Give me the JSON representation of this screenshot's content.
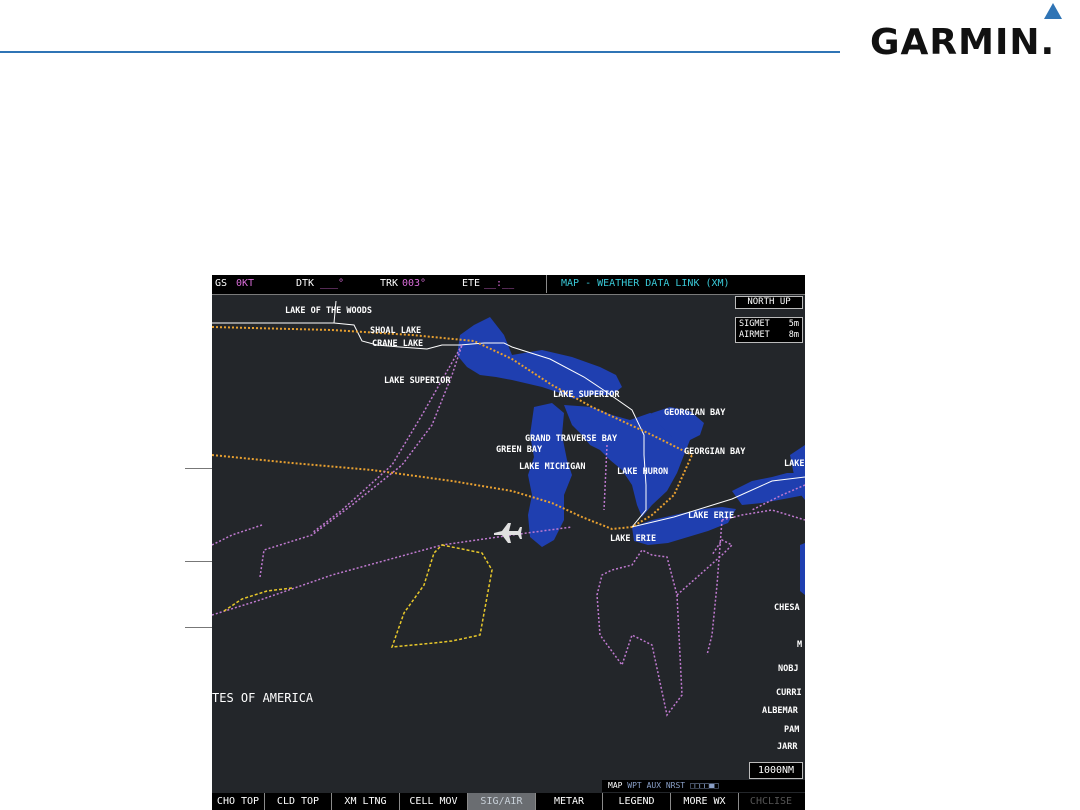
{
  "logo": {
    "text": "GARMIN."
  },
  "topbar": {
    "gs_label": "GS",
    "gs_value": "0KT",
    "dtk_label": "DTK",
    "dtk_value": "___°",
    "trk_label": "TRK",
    "trk_value": "003°",
    "ete_label": "ETE",
    "ete_value": "__:__"
  },
  "page_title": "MAP - WEATHER DATA LINK (XM)",
  "orientation": "NORTH UP",
  "wx_ages": {
    "sigmet_label": "SIGMET",
    "sigmet_age": "5m",
    "airmet_label": "AIRMET",
    "airmet_age": "8m"
  },
  "map_labels": {
    "lake_of_the_woods": "LAKE OF THE WOODS",
    "shoal_lake": "SHOAL LAKE",
    "crane_lake": "CRANE LAKE",
    "lake_superior_w": "LAKE SUPERIOR",
    "lake_superior_e": "LAKE SUPERIOR",
    "georgian_bay_n": "GEORGIAN BAY",
    "georgian_bay_s": "GEORGIAN BAY",
    "grand_traverse_bay": "GRAND TRAVERSE BAY",
    "green_bay": "GREEN BAY",
    "lake_michigan": "LAKE MICHIGAN",
    "lake_huron": "LAKE HURON",
    "lake_erie_e": "LAKE ERIE",
    "lake_erie_w": "LAKE ERIE",
    "lake_edge": "LAKE",
    "country": "TES OF AMERICA",
    "chesa": "CHESA",
    "m": "M",
    "nobj": "NOBJ",
    "curri": "CURRI",
    "albemar": "ALBEMAR",
    "pam": "PAM",
    "jarr": "JARR"
  },
  "range": "1000NM",
  "page_group": {
    "items": [
      "MAP",
      "WPT",
      "AUX",
      "NRST"
    ],
    "current": "MAP",
    "dots": "□□□□■□"
  },
  "softkeys": [
    "CHO TOP",
    "CLD TOP",
    "XM LTNG",
    "CELL MOV",
    "SIG/AIR",
    "METAR",
    "LEGEND",
    "MORE WX",
    "CHCLISE"
  ],
  "active_softkey": "SIG/AIR",
  "colors": {
    "accent": "#2f74b5",
    "screen_bg": "#23262a",
    "water": "#1f3fb0",
    "sigmet": "#e8c82a",
    "airmet": "#c07ad0",
    "tfr_orange": "#e8a030",
    "title_cyan": "#39c8d6",
    "magenta": "#d86cd8"
  }
}
